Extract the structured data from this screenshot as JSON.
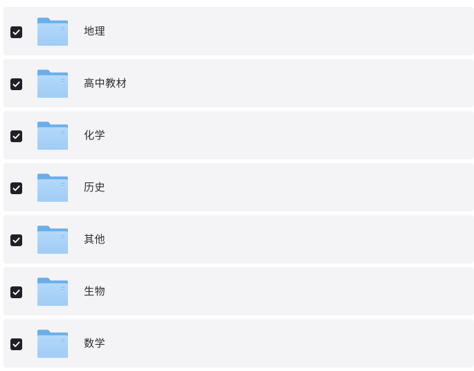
{
  "folders": [
    {
      "name": "地理",
      "checked": true,
      "icon": "folder-icon"
    },
    {
      "name": "高中教材",
      "checked": true,
      "icon": "folder-icon"
    },
    {
      "name": "化学",
      "checked": true,
      "icon": "folder-icon"
    },
    {
      "name": "历史",
      "checked": true,
      "icon": "folder-icon"
    },
    {
      "name": "其他",
      "checked": true,
      "icon": "folder-icon"
    },
    {
      "name": "生物",
      "checked": true,
      "icon": "folder-icon"
    },
    {
      "name": "数学",
      "checked": true,
      "icon": "folder-icon"
    }
  ],
  "colors": {
    "row_background": "#f4f4f6",
    "checkbox_fill": "#1f2127",
    "folder_back": "#6fb0ea",
    "folder_front": "#a9d2f7",
    "text": "#2b2d33"
  }
}
